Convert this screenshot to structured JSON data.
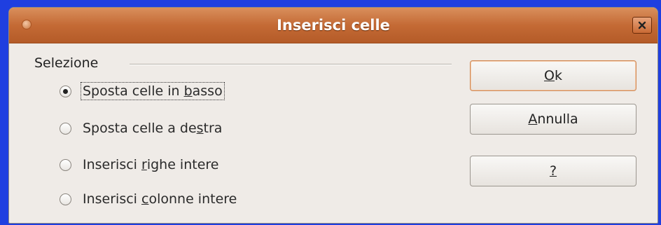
{
  "window": {
    "title": "Inserisci celle"
  },
  "selection_group": {
    "label": "Selezione",
    "options": [
      {
        "pre": "Sposta celle in ",
        "mnemonic": "b",
        "post": "asso",
        "selected": true
      },
      {
        "pre": "Sposta celle a de",
        "mnemonic": "s",
        "post": "tra",
        "selected": false
      },
      {
        "pre": "Inserisci ",
        "mnemonic": "r",
        "post": "ighe intere",
        "selected": false
      },
      {
        "pre": "Inserisci ",
        "mnemonic": "c",
        "post": "olonne intere",
        "selected": false
      }
    ]
  },
  "buttons": {
    "ok": {
      "mnemonic": "O",
      "post": "k"
    },
    "cancel": {
      "mnemonic": "A",
      "post": "nnulla"
    },
    "help": {
      "mnemonic": "?",
      "post": ""
    }
  },
  "colors": {
    "titlebar": "#c46a35",
    "desktop": "#1f3fe0",
    "dialog_bg": "#efebe7",
    "default_button_border": "#d08a58"
  },
  "icons": {
    "window_menu": "window-menu-orb-icon",
    "close": "close-icon"
  }
}
